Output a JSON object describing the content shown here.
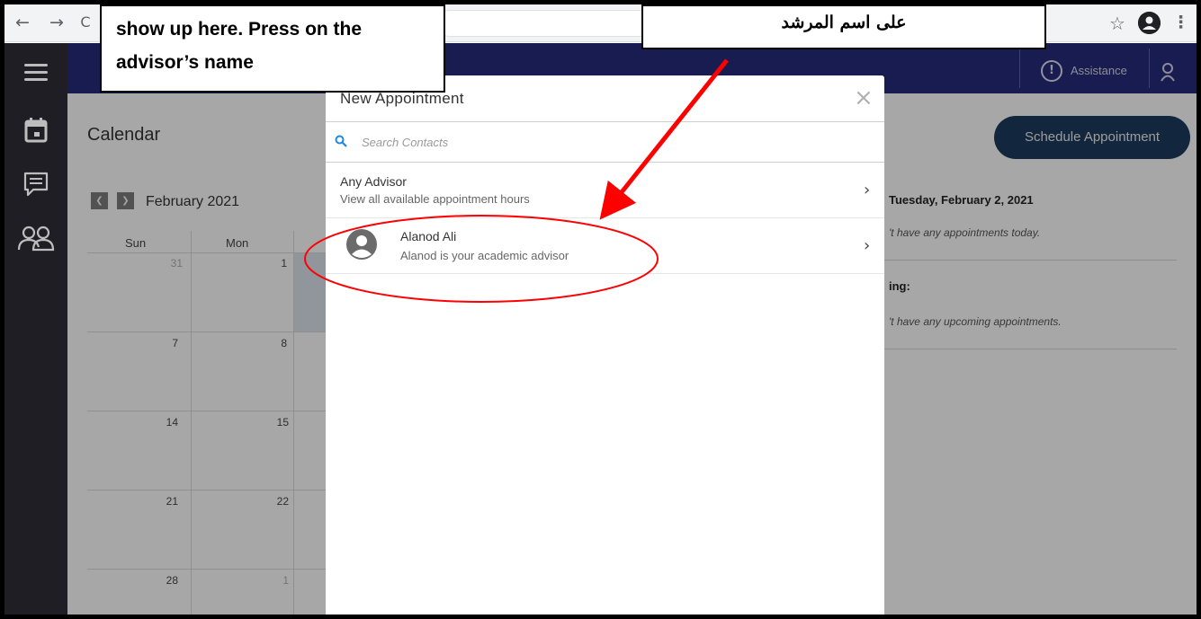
{
  "browser": {
    "back_icon": "←",
    "forward_icon": "→",
    "reload_icon": "C",
    "star_icon": "☆",
    "menu_icon": "⋮"
  },
  "header": {
    "assistance_label": "Assistance",
    "bar_color": "#252a78"
  },
  "sidebar": {
    "items": [
      "menu",
      "calendar",
      "messages",
      "people"
    ]
  },
  "calendar": {
    "title": "Calendar",
    "month": "February 2021",
    "day_headers": [
      "Sun",
      "Mon"
    ],
    "weeks": [
      [
        "31",
        "1"
      ],
      [
        "7",
        "8"
      ],
      [
        "14",
        "15"
      ],
      [
        "21",
        "22"
      ],
      [
        "28",
        "1"
      ]
    ]
  },
  "right_panel": {
    "schedule_button": "Schedule Appointment",
    "date_heading": "Tuesday, February 2, 2021",
    "no_today": "'t have any appointments today.",
    "upcoming_heading": "ing:",
    "no_upcoming": "'t have any upcoming appointments."
  },
  "modal": {
    "title": "New Appointment",
    "close_icon": "×",
    "search_placeholder": "Search Contacts",
    "items": [
      {
        "title": "Any Advisor",
        "subtitle": "View all available appointment hours"
      },
      {
        "title": "Alanod Ali",
        "subtitle": "Alanod is your academic advisor"
      }
    ],
    "chevron": "›"
  },
  "annotations": {
    "left_lines": [
      "show up here. Press on the",
      "advisor’s name"
    ],
    "right_line": "على اسم المرشد",
    "arrow_color": "#ff0000"
  }
}
